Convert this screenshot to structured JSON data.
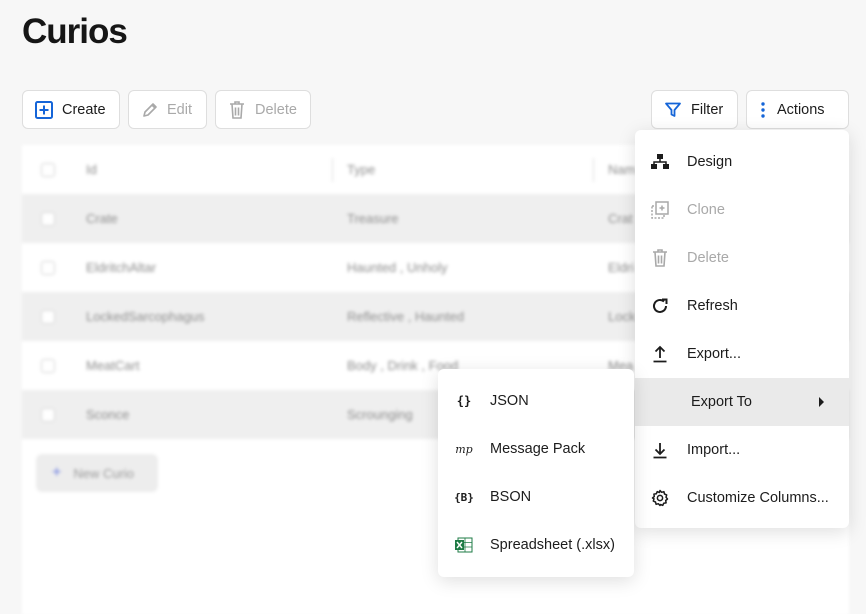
{
  "page": {
    "title": "Curios"
  },
  "toolbar": {
    "create_label": "Create",
    "edit_label": "Edit",
    "delete_label": "Delete",
    "filter_label": "Filter",
    "actions_label": "Actions"
  },
  "table": {
    "columns": [
      "Id",
      "Type",
      "Nam"
    ],
    "rows": [
      {
        "id": "Crate",
        "type": "Treasure",
        "name": "Crat"
      },
      {
        "id": "EldritchAltar",
        "type": "Haunted , Unholy",
        "name": "Eldri"
      },
      {
        "id": "LockedSarcophagus",
        "type": "Reflective , Haunted",
        "name": "Lock"
      },
      {
        "id": "MeatCart",
        "type": "Body , Drink , Food",
        "name": "Mea"
      },
      {
        "id": "Sconce",
        "type": "Scrounging",
        "name": ""
      }
    ],
    "new_label": "New Curio"
  },
  "actions_menu": {
    "items": [
      {
        "label": "Design",
        "icon": "sitemap-icon",
        "disabled": false
      },
      {
        "label": "Clone",
        "icon": "clone-icon",
        "disabled": true
      },
      {
        "label": "Delete",
        "icon": "trash-icon",
        "disabled": true
      },
      {
        "label": "Refresh",
        "icon": "refresh-icon",
        "disabled": false
      },
      {
        "label": "Export...",
        "icon": "upload-icon",
        "disabled": false
      },
      {
        "label": "Export To",
        "icon": "caret-right-icon",
        "disabled": false
      },
      {
        "label": "Import...",
        "icon": "download-icon",
        "disabled": false
      },
      {
        "label": "Customize Columns...",
        "icon": "gear-icon",
        "disabled": false
      }
    ]
  },
  "export_submenu": {
    "items": [
      {
        "label": "JSON",
        "glyph": "{}"
      },
      {
        "label": "Message Pack",
        "glyph": "mp"
      },
      {
        "label": "BSON",
        "glyph": "{B}"
      },
      {
        "label": "Spreadsheet (.xlsx)",
        "glyph": "excel-icon"
      }
    ]
  },
  "colors": {
    "accent": "#1565d8",
    "excel": "#1e7b45",
    "disabled": "#a9a9a9"
  }
}
